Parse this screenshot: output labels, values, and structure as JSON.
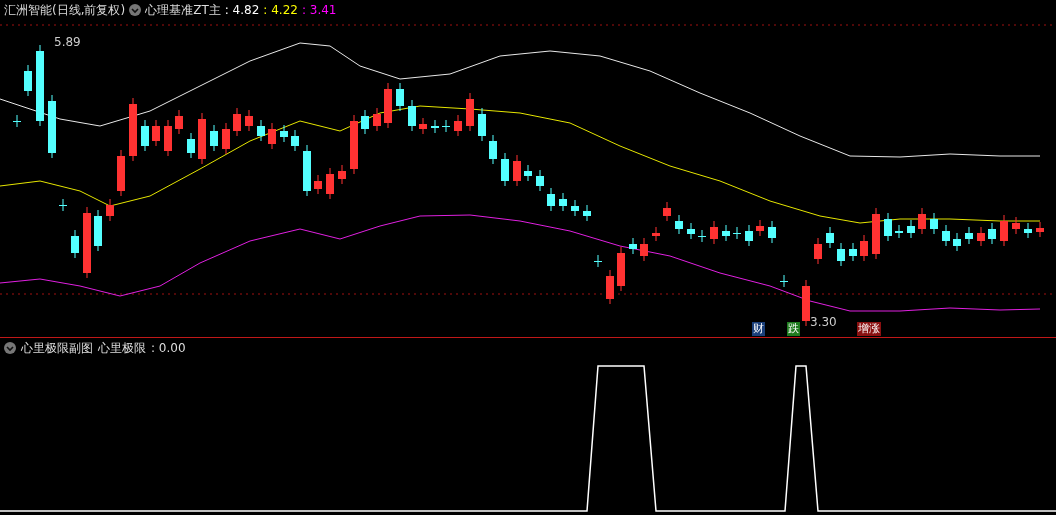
{
  "header": {
    "stock": "汇洲智能(日线,前复权)",
    "indicator": "心理基准ZT主",
    "values": [
      {
        "text": ": 4.82",
        "color": "#ffffff"
      },
      {
        "text": ": 4.22",
        "color": "#ffff00"
      },
      {
        "text": ": 3.41",
        "color": "#ff00ff"
      }
    ]
  },
  "main_chart": {
    "high_label": "5.89",
    "low_label": "3.30",
    "tags": [
      {
        "text": "财",
        "color": "#1a3f7a"
      },
      {
        "text": "跌",
        "color": "#1e7a1e"
      },
      {
        "text": "增涨",
        "color": "#8a1010"
      }
    ]
  },
  "sub_panel": {
    "title": "心里极限副图",
    "indicator": "心里极限",
    "value": ": 0.00"
  }
}
